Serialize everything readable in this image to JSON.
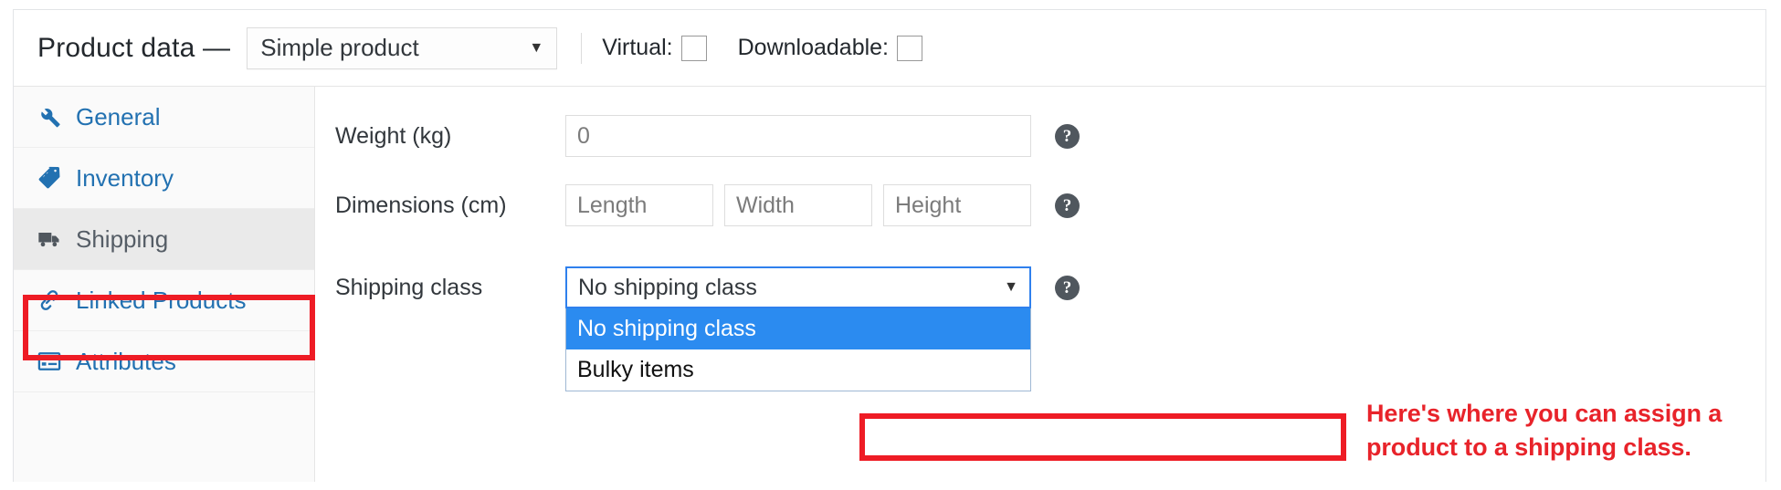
{
  "header": {
    "title": "Product data —",
    "product_type": {
      "value": "Simple product",
      "caret": "▼"
    },
    "checkboxes": [
      {
        "label": "Virtual:",
        "checked": false,
        "name": "virtual"
      },
      {
        "label": "Downloadable:",
        "checked": false,
        "name": "downloadable"
      }
    ]
  },
  "sidebar": {
    "items": [
      {
        "label": "General",
        "icon": "wrench-icon",
        "active": false
      },
      {
        "label": "Inventory",
        "icon": "tag-icon",
        "active": false
      },
      {
        "label": "Shipping",
        "icon": "truck-icon",
        "active": true
      },
      {
        "label": "Linked Products",
        "icon": "link-icon",
        "active": false
      },
      {
        "label": "Attributes",
        "icon": "list-table-icon",
        "active": false
      }
    ]
  },
  "fields": {
    "weight": {
      "label": "Weight (kg)",
      "value": "",
      "placeholder": "0"
    },
    "dimensions": {
      "label": "Dimensions (cm)",
      "inputs": [
        {
          "placeholder": "Length",
          "value": ""
        },
        {
          "placeholder": "Width",
          "value": ""
        },
        {
          "placeholder": "Height",
          "value": ""
        }
      ]
    },
    "shipping_class": {
      "label": "Shipping class",
      "value": "No shipping class",
      "caret": "▼",
      "options": [
        {
          "label": "No shipping class",
          "selected": true
        },
        {
          "label": "Bulky items",
          "selected": false
        }
      ]
    },
    "help_icon_glyph": "?"
  },
  "annotations": {
    "callout_text": "Here's where you can assign a product to a shipping class.",
    "highlight_color": "#ee1c25"
  },
  "colors": {
    "link_blue": "#2271b1",
    "focus_blue": "#2f80ed",
    "option_highlight": "#2b8bf0",
    "annotation_red": "#e8232a",
    "active_tab_bg": "#eaeaea"
  }
}
